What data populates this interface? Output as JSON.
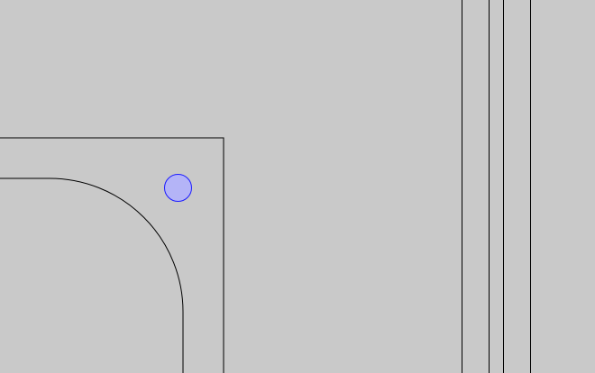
{
  "viewport": {
    "background": "#c9c9c9"
  },
  "scene": {
    "stroke_color": "#000000",
    "marker": {
      "fill": "#b4b4f7",
      "stroke": "#1a1aff",
      "icon": "circle-marker"
    }
  }
}
